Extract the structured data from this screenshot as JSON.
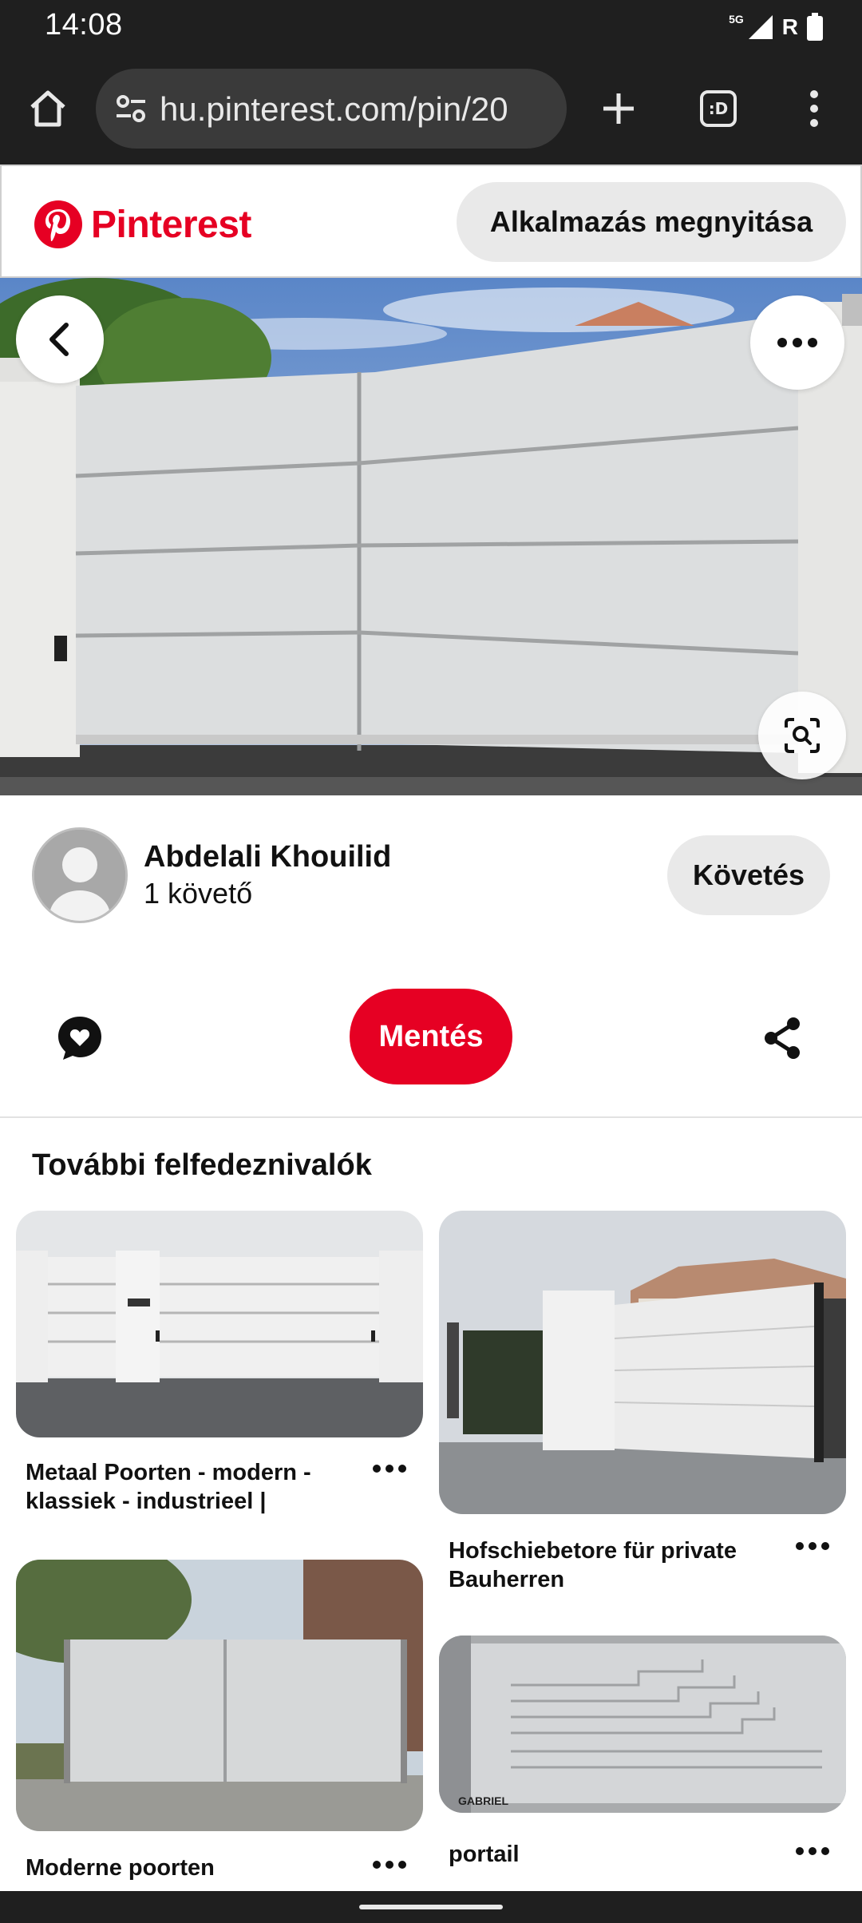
{
  "status_bar": {
    "time": "14:08",
    "network": "5G",
    "roaming": "R",
    "icons": [
      "signal-icon",
      "battery-icon"
    ]
  },
  "browser": {
    "url": "hu.pinterest.com/pin/20",
    "icons": [
      "home-icon",
      "site-settings-icon",
      "plus-icon",
      "tab-switcher-icon",
      "overflow-menu-icon"
    ],
    "tab_label": ":D"
  },
  "header": {
    "logo_text": "Pinterest",
    "open_app_label": "Alkalmazás megnyitása",
    "brand_color": "#e60023"
  },
  "pin": {
    "icons": [
      "back-arrow-icon",
      "more-options-icon",
      "visual-search-icon"
    ]
  },
  "creator": {
    "name": "Abdelali Khouilid",
    "followers": "1 követő",
    "follow_label": "Követés"
  },
  "actions": {
    "save_label": "Mentés",
    "icons": [
      "comment-heart-icon",
      "share-icon"
    ]
  },
  "explore": {
    "title": "További felfedeznivalók",
    "cards": [
      {
        "title": "Metaal Poorten - modern - klassiek - industrieel | Bilzen…"
      },
      {
        "title": "Hofschiebetore für private Bauherren"
      },
      {
        "title": "Moderne poorten"
      },
      {
        "title": "portail",
        "image_text": "GABRIEL"
      }
    ]
  }
}
